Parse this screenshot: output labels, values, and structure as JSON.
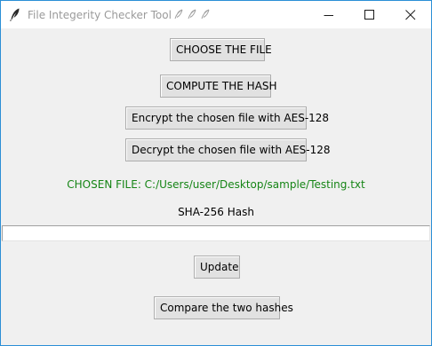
{
  "window": {
    "title": "File Integerity Checker Tool"
  },
  "buttons": {
    "choose": "CHOOSE THE FILE",
    "compute": "COMPUTE THE HASH",
    "encrypt": "Encrypt the chosen file with AES-128",
    "decrypt": "Decrypt the chosen file with AES-128",
    "update": "Update",
    "compare": "Compare the two hashes"
  },
  "chosen_file": "CHOSEN FILE: C:/Users/user/Desktop/sample/Testing.txt",
  "hash": {
    "label": "SHA-256 Hash",
    "value": ""
  },
  "colors": {
    "chosen_file_text": "#168516",
    "window_border": "#2b8fd6",
    "background": "#f0f0f0"
  }
}
